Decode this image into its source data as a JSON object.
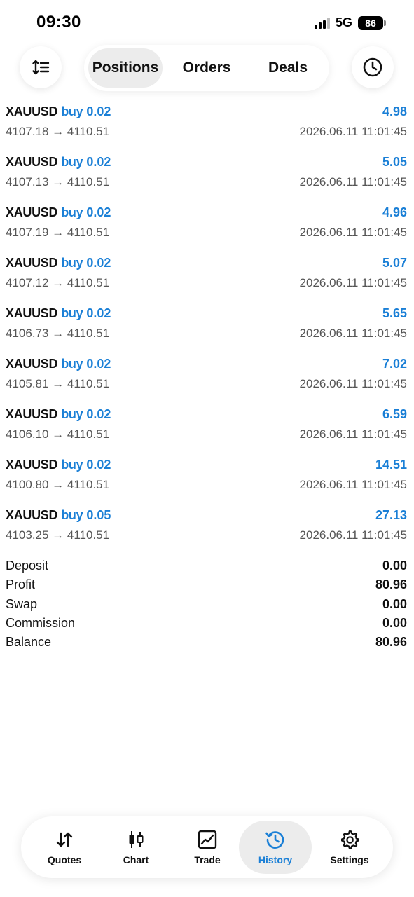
{
  "status": {
    "time": "09:30",
    "network": "5G",
    "battery": "86"
  },
  "toolbar": {
    "sort_icon": "sort-icon",
    "history_icon": "clock-icon",
    "tabs": [
      {
        "label": "Positions",
        "active": true
      },
      {
        "label": "Orders",
        "active": false
      },
      {
        "label": "Deals",
        "active": false
      }
    ]
  },
  "deals": [
    {
      "symbol": "XAUUSD",
      "side": "buy",
      "volume": "0.02",
      "profit": "4.98",
      "prices": "4107.18 → 4110.51",
      "time": "2026.06.11 11:01:45"
    },
    {
      "symbol": "XAUUSD",
      "side": "buy",
      "volume": "0.02",
      "profit": "5.05",
      "prices": "4107.13 → 4110.51",
      "time": "2026.06.11 11:01:45"
    },
    {
      "symbol": "XAUUSD",
      "side": "buy",
      "volume": "0.02",
      "profit": "4.96",
      "prices": "4107.19 → 4110.51",
      "time": "2026.06.11 11:01:45"
    },
    {
      "symbol": "XAUUSD",
      "side": "buy",
      "volume": "0.02",
      "profit": "5.07",
      "prices": "4107.12 → 4110.51",
      "time": "2026.06.11 11:01:45"
    },
    {
      "symbol": "XAUUSD",
      "side": "buy",
      "volume": "0.02",
      "profit": "5.65",
      "prices": "4106.73 → 4110.51",
      "time": "2026.06.11 11:01:45"
    },
    {
      "symbol": "XAUUSD",
      "side": "buy",
      "volume": "0.02",
      "profit": "7.02",
      "prices": "4105.81 → 4110.51",
      "time": "2026.06.11 11:01:45"
    },
    {
      "symbol": "XAUUSD",
      "side": "buy",
      "volume": "0.02",
      "profit": "6.59",
      "prices": "4106.10 → 4110.51",
      "time": "2026.06.11 11:01:45"
    },
    {
      "symbol": "XAUUSD",
      "side": "buy",
      "volume": "0.02",
      "profit": "14.51",
      "prices": "4100.80 → 4110.51",
      "time": "2026.06.11 11:01:45"
    },
    {
      "symbol": "XAUUSD",
      "side": "buy",
      "volume": "0.05",
      "profit": "27.13",
      "prices": "4103.25 → 4110.51",
      "time": "2026.06.11 11:01:45"
    }
  ],
  "summary": [
    {
      "label": "Deposit",
      "value": "0.00"
    },
    {
      "label": "Profit",
      "value": "80.96"
    },
    {
      "label": "Swap",
      "value": "0.00"
    },
    {
      "label": "Commission",
      "value": "0.00"
    },
    {
      "label": "Balance",
      "value": "80.96"
    }
  ],
  "tabbar": [
    {
      "label": "Quotes",
      "icon": "quotes-arrows-icon",
      "active": false
    },
    {
      "label": "Chart",
      "icon": "candlestick-icon",
      "active": false
    },
    {
      "label": "Trade",
      "icon": "trade-line-chart-icon",
      "active": false
    },
    {
      "label": "History",
      "icon": "history-clock-icon",
      "active": true
    },
    {
      "label": "Settings",
      "icon": "gear-icon",
      "active": false
    }
  ],
  "colors": {
    "accent": "#1a7fd6",
    "text": "#111111",
    "muted": "#555555",
    "pill": "#ececec"
  }
}
